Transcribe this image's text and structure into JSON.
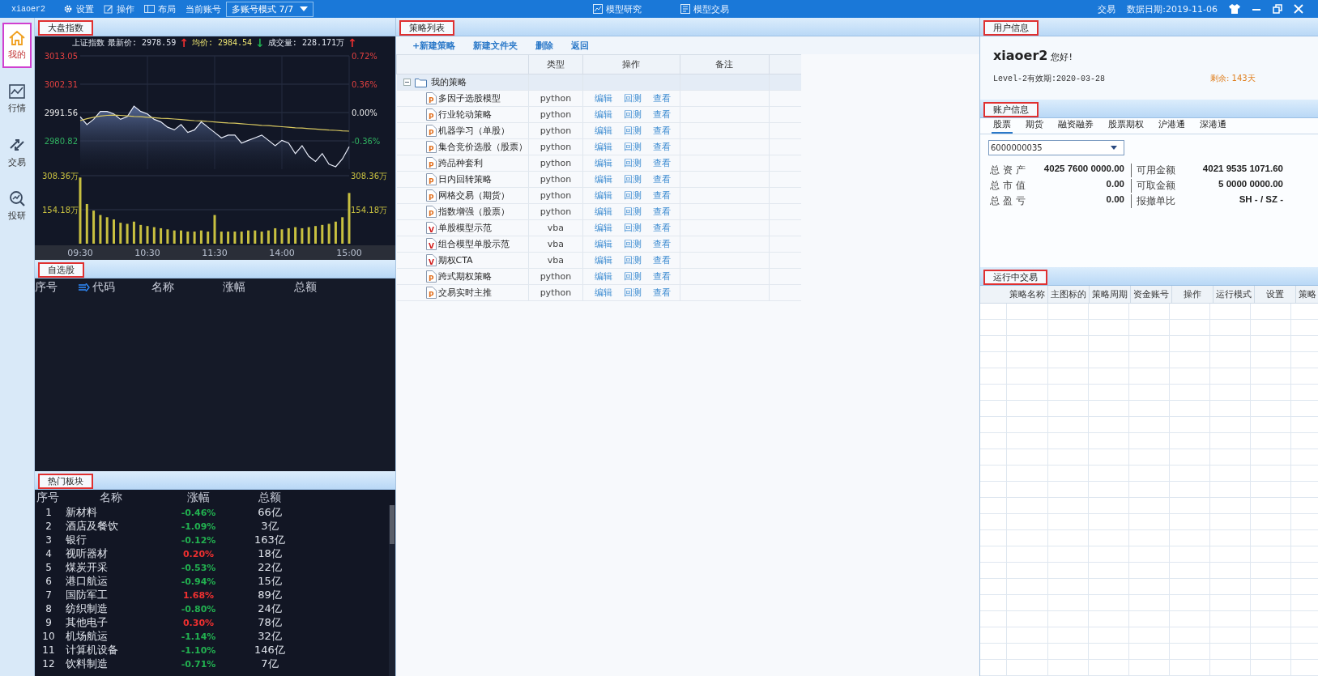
{
  "title_bar": {
    "user": "xiaoer2",
    "tools": [
      {
        "kind": "gear",
        "label": "设置"
      },
      {
        "kind": "edit",
        "label": "操作"
      },
      {
        "kind": "layout",
        "label": "布局"
      }
    ],
    "account_label": "当前账号",
    "account_mode": "多账号模式 7/7",
    "modes": [
      {
        "kind": "research",
        "label": "模型研究"
      },
      {
        "kind": "trade",
        "label": "模型交易"
      }
    ],
    "trade_link": "交易",
    "data_date": "数据日期:2019-11-06"
  },
  "sidebar": {
    "items": [
      {
        "kind": "home",
        "label": "我的",
        "selected": true,
        "annotated": true
      },
      {
        "kind": "market",
        "label": "行情",
        "selected": false,
        "annotated": false
      },
      {
        "kind": "trade",
        "label": "交易",
        "selected": false,
        "annotated": false
      },
      {
        "kind": "research",
        "label": "投研",
        "selected": false,
        "annotated": false
      }
    ]
  },
  "index_panel": {
    "tab": "大盘指数",
    "annotated": true,
    "quote": [
      {
        "kind": "label",
        "text": "上证指数"
      },
      {
        "kind": "value",
        "text": "最新价: 2978.59"
      },
      {
        "kind": "arrow",
        "text": "↑",
        "color": "#f03030"
      },
      {
        "kind": "highlight",
        "text": "均价: 2984.54"
      },
      {
        "kind": "arrow",
        "text": "↓",
        "color": "#20b050"
      },
      {
        "kind": "value",
        "text": "成交量: 228.171万"
      },
      {
        "kind": "arrow",
        "text": "↑",
        "color": "#f03030"
      }
    ],
    "price_chart": {
      "right_labels": [
        "0.72%",
        "0.36%",
        "0.00%",
        "-0.36%"
      ],
      "chart_data": {
        "type": "line",
        "grid": true,
        "ylim": [
          2970.08,
          3013.05
        ],
        "yticks": [
          {
            "value": 3013.05,
            "label": "3013.05"
          },
          {
            "value": 3002.31,
            "label": "3002.31"
          },
          {
            "value": 2991.56,
            "label": "2991.56"
          },
          {
            "value": 2980.82,
            "label": "2980.82"
          }
        ],
        "series": [
          {
            "color": "#e8ecf8",
            "values": [
              2990,
              2987,
              2989,
              2992,
              2992,
              2991,
              2989,
              2990,
              2994,
              2992,
              2991,
              2989,
              2988,
              2986,
              2985,
              2987,
              2984,
              2985,
              2988,
              2986,
              2984,
              2982,
              2983,
              2983,
              2980,
              2981,
              2982,
              2983,
              2981,
              2979,
              2981,
              2980,
              2976,
              2979,
              2975,
              2973,
              2976,
              2972,
              2971,
              2974,
              2978.6
            ]
          },
          {
            "color": "#d8c860",
            "values": [
              2988.5,
              2989.2,
              2989.8,
              2990.2,
              2990.5,
              2990.6,
              2990.5,
              2990.3,
              2990.1,
              2990.0,
              2989.8,
              2989.6,
              2989.4,
              2989.3,
              2989.1,
              2988.9,
              2988.7,
              2988.5,
              2988.4,
              2988.2,
              2988.0,
              2987.8,
              2987.6,
              2987.5,
              2987.3,
              2987.1,
              2986.9,
              2986.7,
              2986.6,
              2986.4,
              2986.2,
              2986.0,
              2985.8,
              2985.7,
              2985.5,
              2985.3,
              2985.1,
              2984.9,
              2984.8,
              2984.6,
              2984.5
            ]
          }
        ]
      }
    },
    "volume_chart": {
      "right_labels": [
        "308.36万",
        "154.18万"
      ],
      "chart_data": {
        "type": "bar",
        "ylim": [
          0,
          308.36
        ],
        "yticks": [
          {
            "value": 308.36,
            "label": "308.36万"
          },
          {
            "value": 154.18,
            "label": "154.18万"
          }
        ],
        "categories": [
          "09:30",
          null,
          null,
          null,
          null,
          null,
          null,
          null,
          null,
          null,
          "10:30",
          null,
          null,
          null,
          null,
          null,
          null,
          null,
          null,
          null,
          "11:30",
          null,
          null,
          null,
          null,
          null,
          null,
          null,
          null,
          null,
          "14:00",
          null,
          null,
          null,
          null,
          null,
          null,
          null,
          null,
          null,
          "15:00"
        ],
        "series": [
          {
            "color": "#c8c040",
            "values": [
              300,
              180,
              150,
              130,
              120,
              110,
              95,
              90,
              100,
              85,
              80,
              75,
              70,
              65,
              60,
              60,
              55,
              55,
              60,
              55,
              130,
              55,
              55,
              55,
              55,
              60,
              60,
              55,
              60,
              70,
              65,
              70,
              75,
              70,
              75,
              80,
              85,
              90,
              100,
              120,
              230
            ]
          }
        ]
      }
    }
  },
  "watchlist": {
    "tab": "自选股",
    "annotated": true,
    "columns": [
      "序号",
      "代码",
      "名称",
      "涨幅",
      "总额"
    ]
  },
  "hot_sectors": {
    "tab": "热门板块",
    "annotated": true,
    "columns": [
      "序号",
      "名称",
      "涨幅",
      "总额"
    ],
    "rows": [
      {
        "no": "1",
        "name": "新材料",
        "change": "-0.46%",
        "color": "#22b050",
        "amount": "66亿"
      },
      {
        "no": "2",
        "name": "酒店及餐饮",
        "change": "-1.09%",
        "color": "#22b050",
        "amount": "3亿"
      },
      {
        "no": "3",
        "name": "银行",
        "change": "-0.12%",
        "color": "#22b050",
        "amount": "163亿"
      },
      {
        "no": "4",
        "name": "视听器材",
        "change": "0.20%",
        "color": "#f03030",
        "amount": "18亿"
      },
      {
        "no": "5",
        "name": "煤炭开采",
        "change": "-0.53%",
        "color": "#22b050",
        "amount": "22亿"
      },
      {
        "no": "6",
        "name": "港口航运",
        "change": "-0.94%",
        "color": "#22b050",
        "amount": "15亿"
      },
      {
        "no": "7",
        "name": "国防军工",
        "change": "1.68%",
        "color": "#f03030",
        "amount": "89亿"
      },
      {
        "no": "8",
        "name": "纺织制造",
        "change": "-0.80%",
        "color": "#22b050",
        "amount": "24亿"
      },
      {
        "no": "9",
        "name": "其他电子",
        "change": "0.30%",
        "color": "#f03030",
        "amount": "78亿"
      },
      {
        "no": "10",
        "name": "机场航运",
        "change": "-1.14%",
        "color": "#22b050",
        "amount": "32亿"
      },
      {
        "no": "11",
        "name": "计算机设备",
        "change": "-1.10%",
        "color": "#22b050",
        "amount": "146亿"
      },
      {
        "no": "12",
        "name": "饮料制造",
        "change": "-0.71%",
        "color": "#22b050",
        "amount": "7亿"
      }
    ]
  },
  "strategy_panel": {
    "tab": "策略列表",
    "annotated": true,
    "toolbar": [
      "+新建策略",
      "新建文件夹",
      "删除",
      "返回"
    ],
    "columns": [
      "类型",
      "操作",
      "备注"
    ],
    "folder": {
      "name": "我的策略",
      "expanded": true,
      "children": [
        {
          "name": "多因子选股模型",
          "kind": "python",
          "letter": "P",
          "type": "python",
          "actions": [
            "编辑",
            "回测",
            "查看"
          ]
        },
        {
          "name": "行业轮动策略",
          "kind": "python",
          "letter": "P",
          "type": "python",
          "actions": [
            "编辑",
            "回测",
            "查看"
          ]
        },
        {
          "name": "机器学习（单股）",
          "kind": "python",
          "letter": "P",
          "type": "python",
          "actions": [
            "编辑",
            "回测",
            "查看"
          ]
        },
        {
          "name": "集合竞价选股（股票）",
          "kind": "python",
          "letter": "P",
          "type": "python",
          "actions": [
            "编辑",
            "回测",
            "查看"
          ]
        },
        {
          "name": "跨品种套利",
          "kind": "python",
          "letter": "P",
          "type": "python",
          "actions": [
            "编辑",
            "回测",
            "查看"
          ]
        },
        {
          "name": "日内回转策略",
          "kind": "python",
          "letter": "P",
          "type": "python",
          "actions": [
            "编辑",
            "回测",
            "查看"
          ]
        },
        {
          "name": "网格交易（期货）",
          "kind": "python",
          "letter": "P",
          "type": "python",
          "actions": [
            "编辑",
            "回测",
            "查看"
          ]
        },
        {
          "name": "指数增强（股票）",
          "kind": "python",
          "letter": "P",
          "type": "python",
          "actions": [
            "编辑",
            "回测",
            "查看"
          ]
        },
        {
          "name": "单股模型示范",
          "kind": "vba",
          "letter": "V",
          "type": "vba",
          "actions": [
            "编辑",
            "回测",
            "查看"
          ]
        },
        {
          "name": "组合模型单股示范",
          "kind": "vba",
          "letter": "V",
          "type": "vba",
          "actions": [
            "编辑",
            "回测",
            "查看"
          ]
        },
        {
          "name": "期权CTA",
          "kind": "vba",
          "letter": "V",
          "type": "vba",
          "actions": [
            "编辑",
            "回测",
            "查看"
          ]
        },
        {
          "name": "跨式期权策略",
          "kind": "python",
          "letter": "P",
          "type": "python",
          "actions": [
            "编辑",
            "回测",
            "查看"
          ]
        },
        {
          "name": "交易实时主推",
          "kind": "python",
          "letter": "P",
          "type": "python",
          "actions": [
            "编辑",
            "回测",
            "查看"
          ]
        }
      ]
    }
  },
  "user_panel": {
    "tab": "用户信息",
    "annotated": true,
    "username": "xiaoer2",
    "greeting": "您好!",
    "validity": "Level-2有效期:2020-03-28",
    "remaining": "剩余: 143天"
  },
  "account_panel": {
    "tab": "账户信息",
    "annotated": true,
    "tabs": [
      {
        "label": "股票",
        "selected": true
      },
      {
        "label": "期货",
        "selected": false
      },
      {
        "label": "融资融券",
        "selected": false
      },
      {
        "label": "股票期权",
        "selected": false
      },
      {
        "label": "沪港通",
        "selected": false
      },
      {
        "label": "深港通",
        "selected": false
      }
    ],
    "account": "6000000035",
    "stats": [
      {
        "label": "总 资 产",
        "value": "4025 7600 0000.00",
        "label2": "可用金额",
        "value2": "4021 9535 1071.60"
      },
      {
        "label": "总 市 值",
        "value": "0.00",
        "label2": "可取金额",
        "value2": "5 0000 0000.00"
      },
      {
        "label": "总 盈 亏",
        "value": "0.00",
        "label2": "报撤单比",
        "value2": "SH - / SZ -"
      }
    ]
  },
  "running_panel": {
    "tab": "运行中交易",
    "annotated": true,
    "columns": [
      "策略名称",
      "主图标的",
      "策略周期",
      "资金账号",
      "操作",
      "运行模式",
      "设置",
      "策略"
    ]
  }
}
